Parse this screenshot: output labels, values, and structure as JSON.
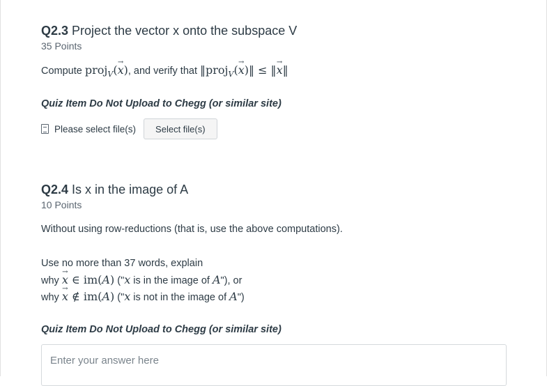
{
  "q23": {
    "number": "Q2.3",
    "title": "Project the vector x onto the subspace V",
    "points": "35 Points",
    "instruction_prefix": "Compute",
    "instruction_mid": ", and verify that",
    "proj_text": "proj",
    "proj_sub": "V",
    "notice": "Quiz Item Do Not Upload to Chegg (or similar site)",
    "file_label": "Please select file(s)",
    "select_button": "Select file(s)",
    "icon": "file-icon"
  },
  "q24": {
    "number": "Q2.4",
    "title": "Is x in the image of A",
    "points": "10 Points",
    "body": "Without using row-reductions (that is, use the above computations).",
    "line1": "Use no more than 37 words, explain",
    "line2_prefix": "why",
    "line2_mid": " (\"",
    "line2_text": " is in the image of ",
    "line2_suffix": "\"), or",
    "line3_prefix": "why",
    "line3_text": " is not in the image of ",
    "line3_suffix": "\")",
    "im_text": "im",
    "A": "A",
    "x": "x",
    "notice": "Quiz Item Do Not Upload to Chegg (or similar site)",
    "answer_placeholder": "Enter your answer here"
  }
}
